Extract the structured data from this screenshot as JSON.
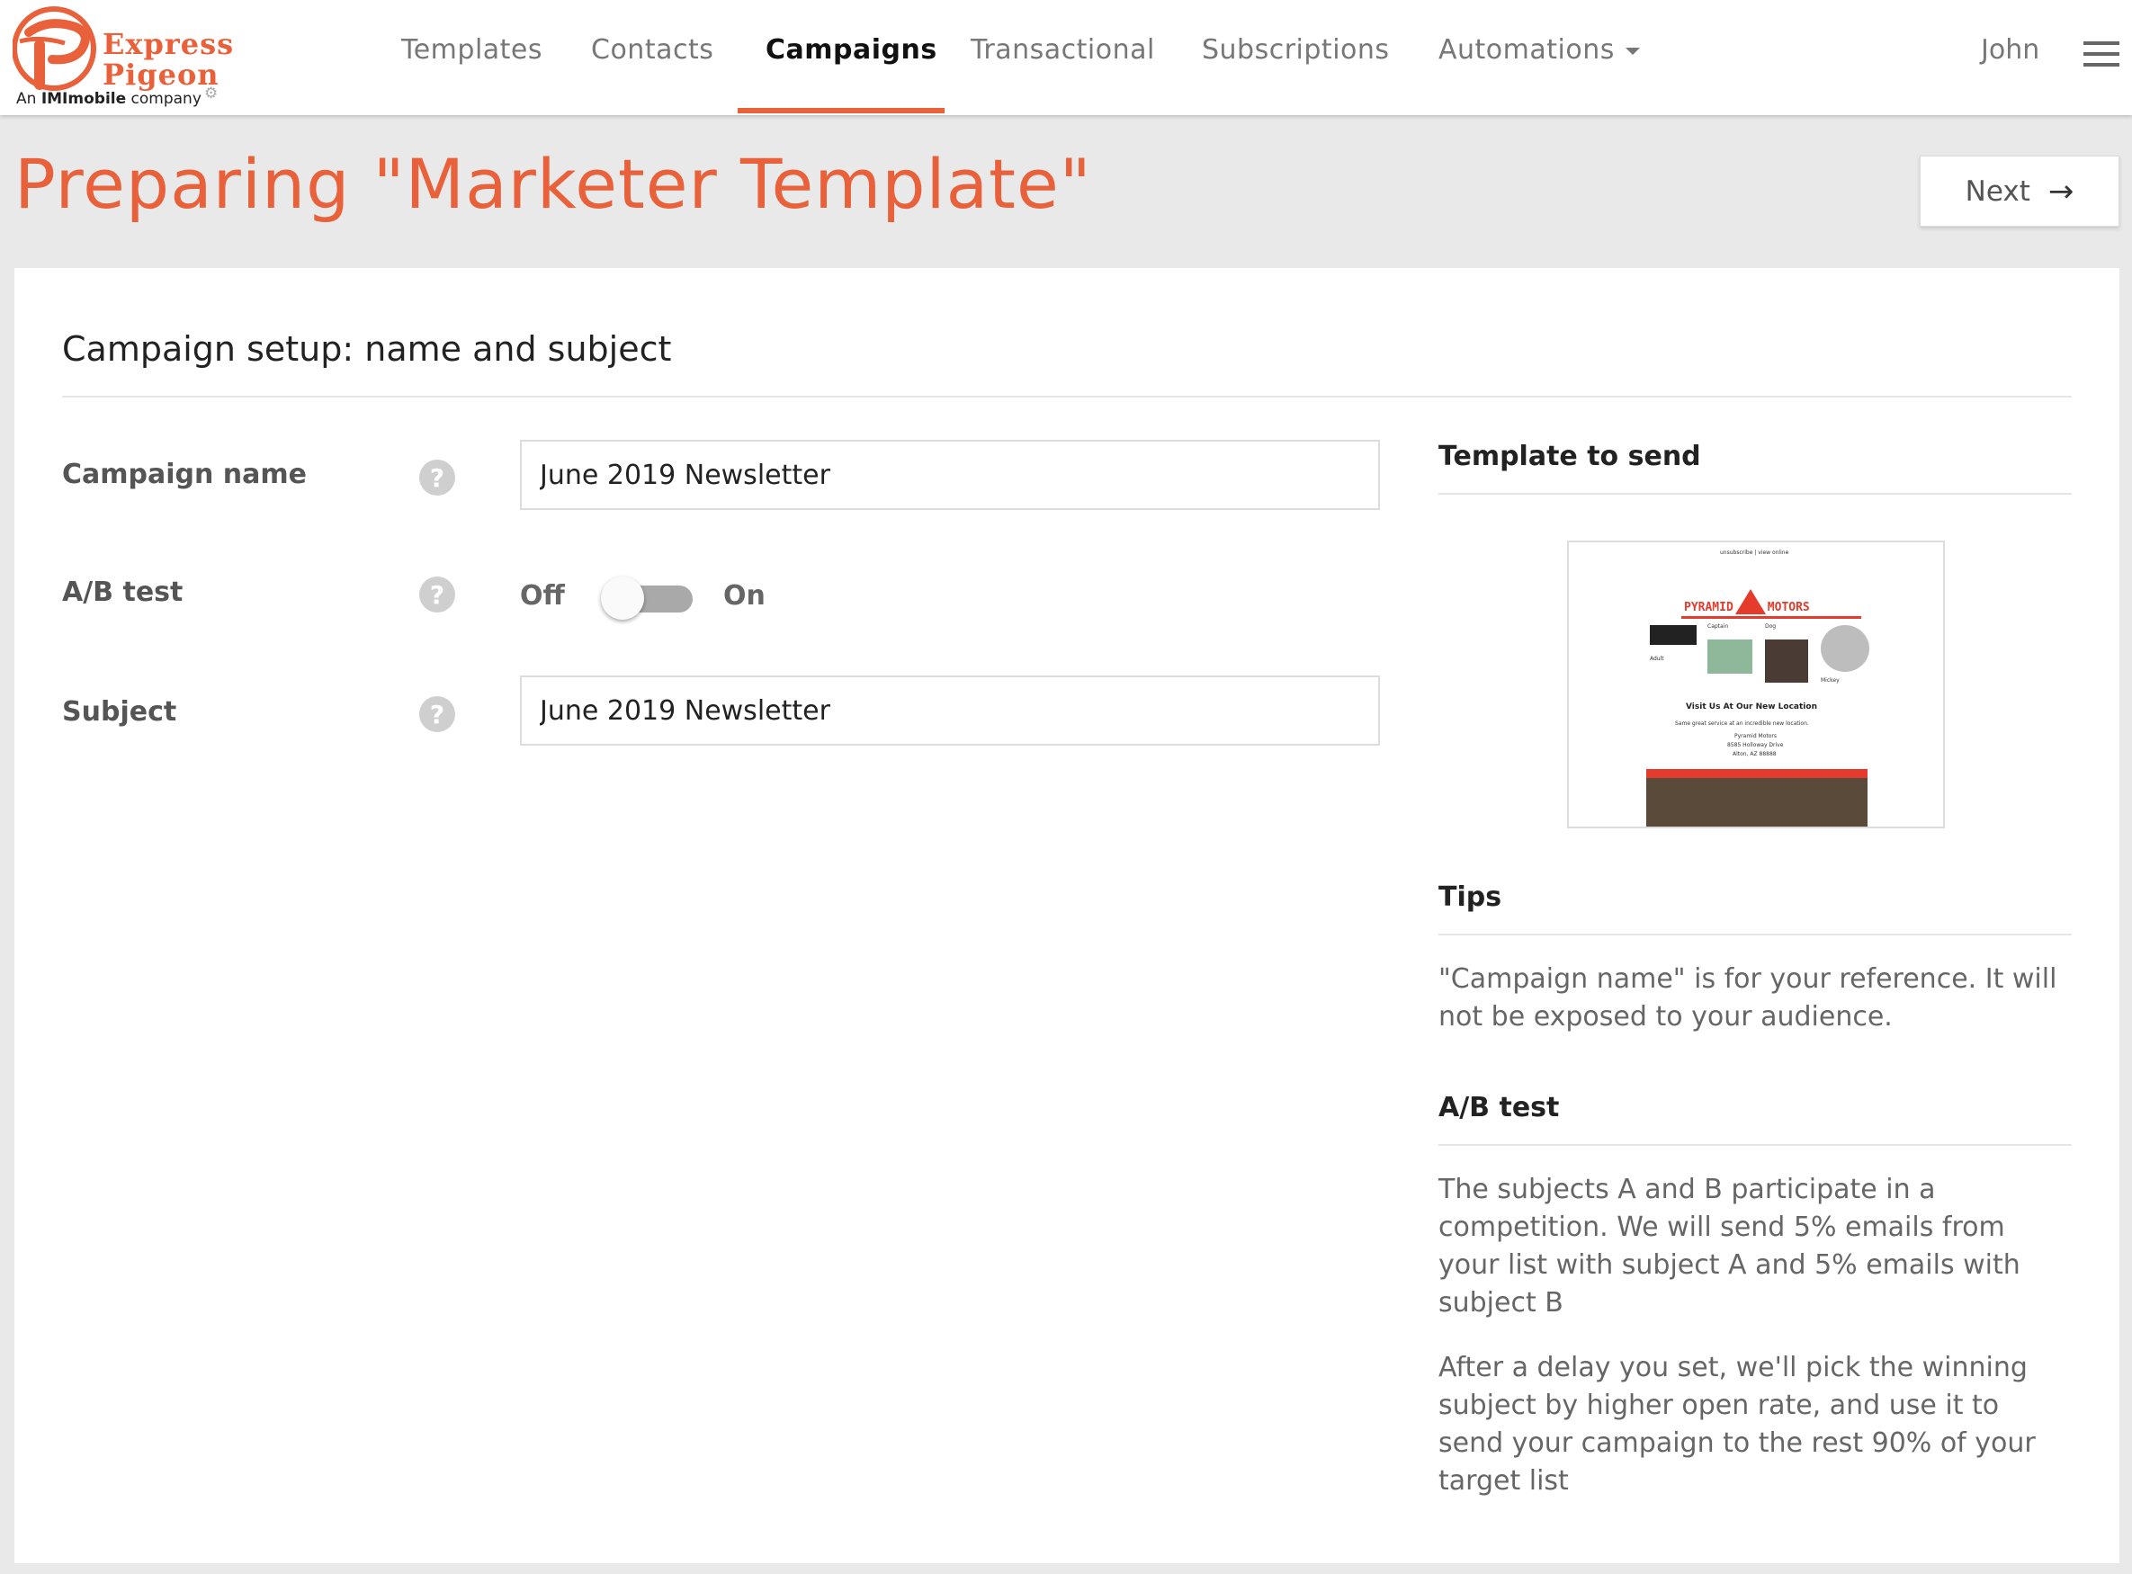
{
  "brand": {
    "line1": "Express",
    "line2": "Pigeon",
    "company_prefix": "An ",
    "company_name": "IMImobile",
    "company_suffix": " company"
  },
  "nav": {
    "items": [
      {
        "label": "Templates",
        "active": false
      },
      {
        "label": "Contacts",
        "active": false
      },
      {
        "label": "Campaigns",
        "active": true
      },
      {
        "label": "Transactional",
        "active": false
      },
      {
        "label": "Subscriptions",
        "active": false
      },
      {
        "label": "Automations",
        "active": false
      }
    ],
    "user": "John"
  },
  "header": {
    "title": "Preparing \"Marketer Template\"",
    "next_label": "Next"
  },
  "form": {
    "section_title": "Campaign setup: name and subject",
    "campaign_name_label": "Campaign name",
    "campaign_name_value": "June 2019 Newsletter",
    "ab_test_label": "A/B test",
    "ab_off_label": "Off",
    "ab_on_label": "On",
    "ab_enabled": false,
    "subject_label": "Subject",
    "subject_value": "June 2019 Newsletter",
    "help_glyph": "?"
  },
  "sidebar": {
    "template_heading": "Template to send",
    "thumbnail": {
      "top_links": "unsubscribe | view online",
      "brand_left": "PYRAMID",
      "brand_right": "MOTORS",
      "label_captain": "Captain",
      "label_dog": "Dog",
      "label_adult": "Adult",
      "label_mickey": "Mickey",
      "heading": "Visit Us At Our New Location",
      "subheading": "Same great service at an incredible new location.",
      "address_1": "Pyramid Motors",
      "address_2": "8585 Holloway Drive",
      "address_3": "Alton, AZ 88888"
    },
    "tips_heading": "Tips",
    "tips_text": "\"Campaign name\" is for your reference. It will not be exposed to your audience.",
    "ab_heading": "A/B test",
    "ab_text_1": "The subjects A and B participate in a competition. We will send 5% emails from your list with subject A and 5% emails with subject B",
    "ab_text_2": "After a delay you set, we'll pick the winning subject by higher open rate, and use it to send your campaign to the rest 90% of your target list"
  },
  "colors": {
    "accent": "#e8613a",
    "background": "#e9e9e9",
    "card": "#ffffff",
    "muted_text": "#777777"
  },
  "icons": [
    "logo-icon",
    "gear-icon",
    "caret-down-icon",
    "hamburger-icon",
    "arrow-right-icon",
    "help-icon"
  ]
}
